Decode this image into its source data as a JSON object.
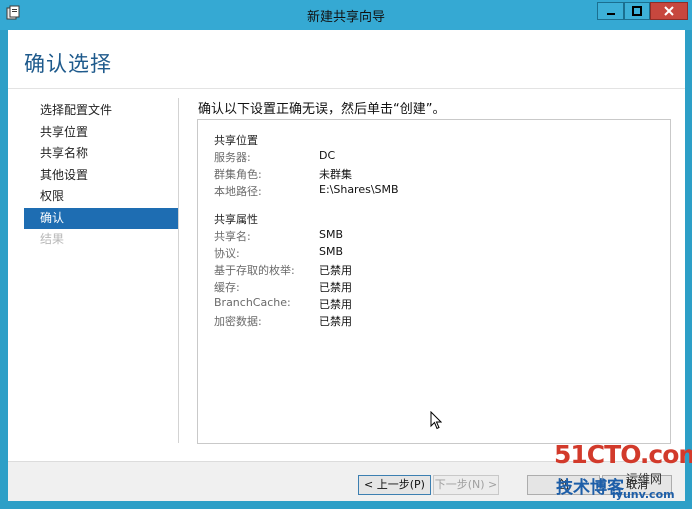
{
  "window": {
    "title": "新建共享向导"
  },
  "page": {
    "heading": "确认选择",
    "instruction": "确认以下设置正确无误，然后单击“创建”。"
  },
  "nav": {
    "items": [
      {
        "label": "选择配置文件",
        "state": "normal"
      },
      {
        "label": "共享位置",
        "state": "normal"
      },
      {
        "label": "共享名称",
        "state": "normal"
      },
      {
        "label": "其他设置",
        "state": "normal"
      },
      {
        "label": "权限",
        "state": "normal"
      },
      {
        "label": "确认",
        "state": "active"
      },
      {
        "label": "结果",
        "state": "disabled"
      }
    ]
  },
  "summary": {
    "location": {
      "title": "共享位置",
      "rows": [
        {
          "label": "服务器:",
          "value": "DC"
        },
        {
          "label": "群集角色:",
          "value": "未群集"
        },
        {
          "label": "本地路径:",
          "value": "E:\\Shares\\SMB"
        }
      ]
    },
    "properties": {
      "title": "共享属性",
      "rows": [
        {
          "label": "共享名:",
          "value": "SMB"
        },
        {
          "label": "协议:",
          "value": "SMB"
        },
        {
          "label": "基于存取的枚举:",
          "value": "已禁用"
        },
        {
          "label": "缓存:",
          "value": "已禁用"
        },
        {
          "label": "BranchCache:",
          "value": "已禁用"
        },
        {
          "label": "加密数据:",
          "value": "已禁用"
        }
      ]
    }
  },
  "footer": {
    "prev_label": "< 上一步(P)",
    "next_label": "下一步(N) >",
    "create_label": "创",
    "cancel_label": "取消"
  },
  "watermark": {
    "brand": "51CTO.com",
    "left": "技术博客",
    "right": "运维网",
    "url": "iyunv.com"
  },
  "colors": {
    "titlebar": "#35a9d3",
    "active_nav": "#1e6db2",
    "heading": "#1e5a8c",
    "close": "#c7473e"
  }
}
